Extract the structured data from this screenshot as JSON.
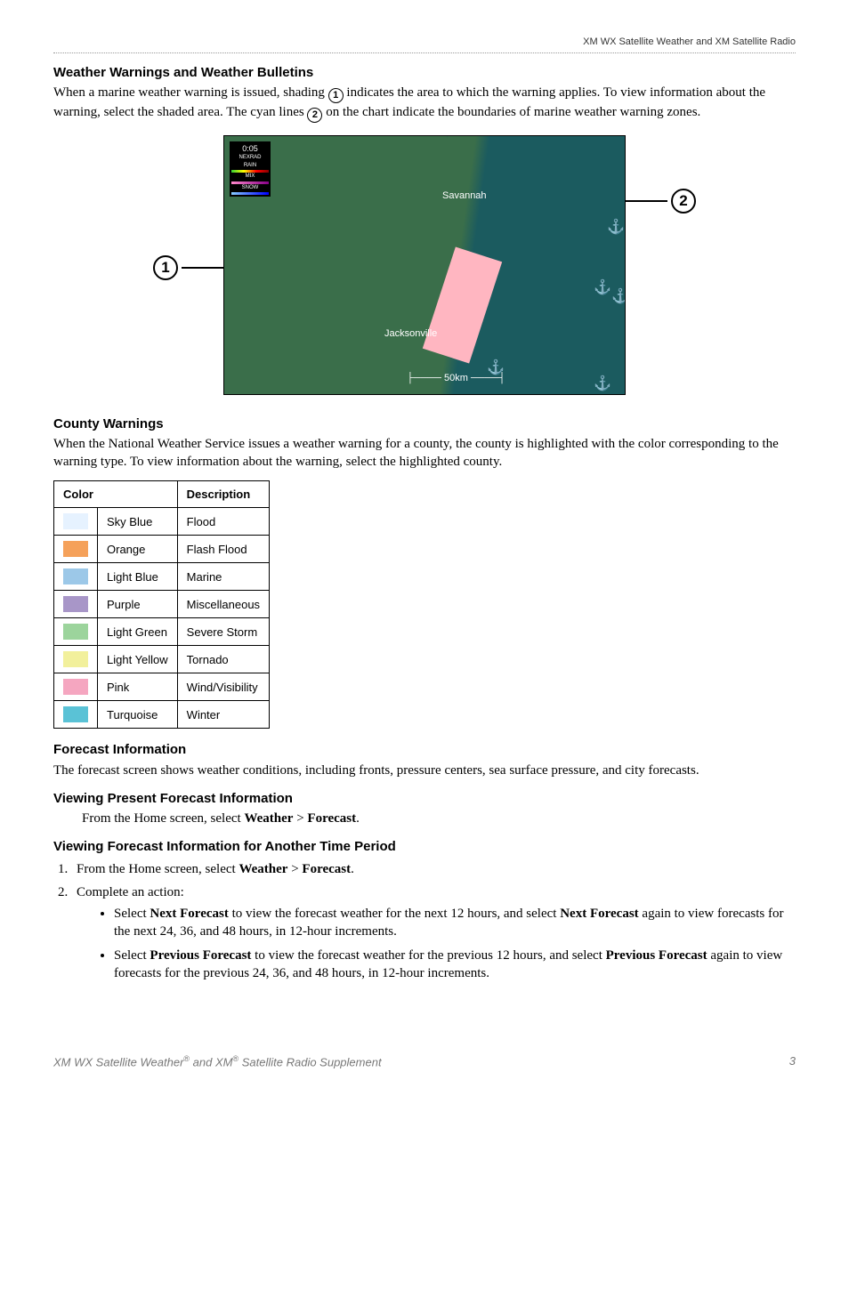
{
  "header": {
    "right": "XM WX Satellite Weather and XM Satellite Radio"
  },
  "s1": {
    "title": "Weather Warnings and Weather Bulletins",
    "p_a": "When a marine weather warning is issued, shading ",
    "n1": "1",
    "p_b": " indicates the area to which the warning applies. To view information about the warning, select the shaded area. The cyan lines ",
    "n2": "2",
    "p_c": " on the chart indicate the boundaries of marine weather warning zones."
  },
  "map": {
    "legend_time": "0:05",
    "legend_src": "NEXRAD",
    "legend_l1": "RAIN",
    "legend_l2": "MIX",
    "legend_l3": "SNOW",
    "city1": "Savannah",
    "city2": "Jacksonville",
    "scale": "50km",
    "callout1": "1",
    "callout2": "2"
  },
  "s2": {
    "title": "County Warnings",
    "p": "When the National Weather Service issues a weather warning for a county, the county is highlighted with the color corresponding to the warning type. To view information about the warning, select the highlighted county."
  },
  "table": {
    "h1": "Color",
    "h2": "Description",
    "rows": [
      {
        "hex": "#e6f2ff",
        "name": "Sky Blue",
        "desc": "Flood"
      },
      {
        "hex": "#f5a15a",
        "name": "Orange",
        "desc": "Flash Flood"
      },
      {
        "hex": "#9cc8e8",
        "name": "Light Blue",
        "desc": "Marine"
      },
      {
        "hex": "#a896c8",
        "name": "Purple",
        "desc": "Miscellaneous"
      },
      {
        "hex": "#9cd49c",
        "name": "Light Green",
        "desc": "Severe Storm"
      },
      {
        "hex": "#f2f09c",
        "name": "Light Yellow",
        "desc": "Tornado"
      },
      {
        "hex": "#f5a6c0",
        "name": "Pink",
        "desc": "Wind/Visibility"
      },
      {
        "hex": "#5ac2d6",
        "name": "Turquoise",
        "desc": "Winter"
      }
    ]
  },
  "s3": {
    "title": "Forecast Information",
    "p": "The forecast screen shows weather conditions, including fronts, pressure centers, sea surface pressure, and city forecasts."
  },
  "s4": {
    "title": "Viewing Present Forecast Information",
    "line_a": "From the Home screen, select ",
    "b1": "Weather",
    "gt": " > ",
    "b2": "Forecast",
    "dot": "."
  },
  "s5": {
    "title": "Viewing Forecast Information for Another Time Period",
    "step1_a": "From the Home screen, select ",
    "step1_b1": "Weather",
    "step1_gt": " > ",
    "step1_b2": "Forecast",
    "step1_dot": ".",
    "step2": "Complete an action:",
    "b1_a": "Select ",
    "b1_bold1": "Next Forecast",
    "b1_b": " to view the forecast weather for the next 12 hours, and select ",
    "b1_bold2": "Next Forecast",
    "b1_c": " again to view forecasts for the next 24, 36, and 48 hours, in 12-hour increments.",
    "b2_a": "Select ",
    "b2_bold1": "Previous Forecast",
    "b2_b": " to view the forecast weather for the previous 12 hours, and select ",
    "b2_bold2": "Previous Forecast",
    "b2_c": " again to view forecasts for the previous 24, 36, and 48 hours, in 12-hour increments."
  },
  "footer": {
    "left_a": "XM WX Satellite Weather",
    "left_b": " and XM",
    "left_c": " Satellite Radio Supplement",
    "reg": "®",
    "page": "3"
  }
}
